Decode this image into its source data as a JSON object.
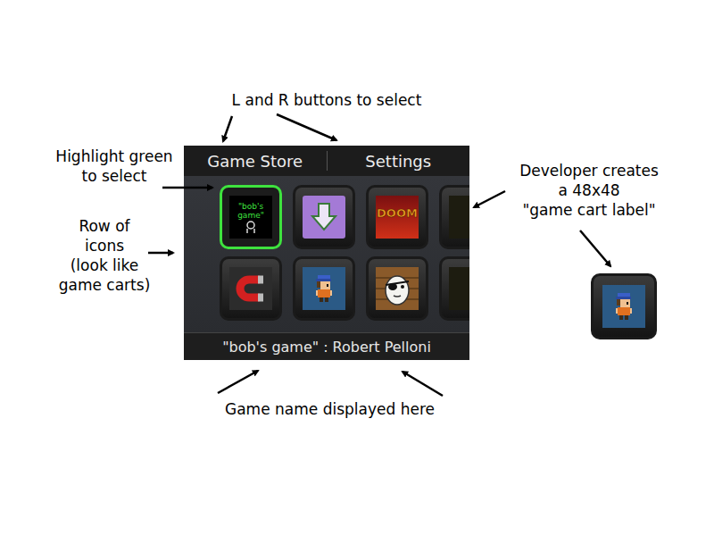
{
  "annotations": [
    {
      "lines": [
        "L and R buttons to select"
      ]
    },
    {
      "lines": [
        "Highlight green",
        "to select"
      ]
    },
    {
      "lines": [
        "Row of",
        "icons",
        "(look like",
        "game carts)"
      ]
    },
    {
      "lines": [
        "Developer creates",
        "a 48x48",
        "\"game cart label\""
      ]
    },
    {
      "lines": [
        "Game name displayed here"
      ]
    }
  ],
  "panel": {
    "tabs": [
      {
        "label": "Game Store",
        "selected": false
      },
      {
        "label": "Settings",
        "selected": false
      }
    ],
    "cards": [
      {
        "kind": "bobs-game",
        "label": "\"bob's game\"",
        "selected": true
      },
      {
        "kind": "download-arrow",
        "label": "",
        "selected": false
      },
      {
        "kind": "doom",
        "label": "DOOM",
        "selected": false
      },
      {
        "kind": "blank",
        "label": "",
        "selected": false
      },
      {
        "kind": "magnet",
        "label": "",
        "selected": false
      },
      {
        "kind": "pixel-character",
        "label": "",
        "selected": false
      },
      {
        "kind": "egg-eye-patch",
        "label": "",
        "selected": false
      },
      {
        "kind": "blank",
        "label": "",
        "selected": false
      }
    ],
    "footer": {
      "game": "\"bob's game\"",
      "separator": ":",
      "developer": "Robert Pelloni"
    }
  },
  "example_card": {
    "kind": "pixel-character",
    "label": "",
    "selected": false
  }
}
